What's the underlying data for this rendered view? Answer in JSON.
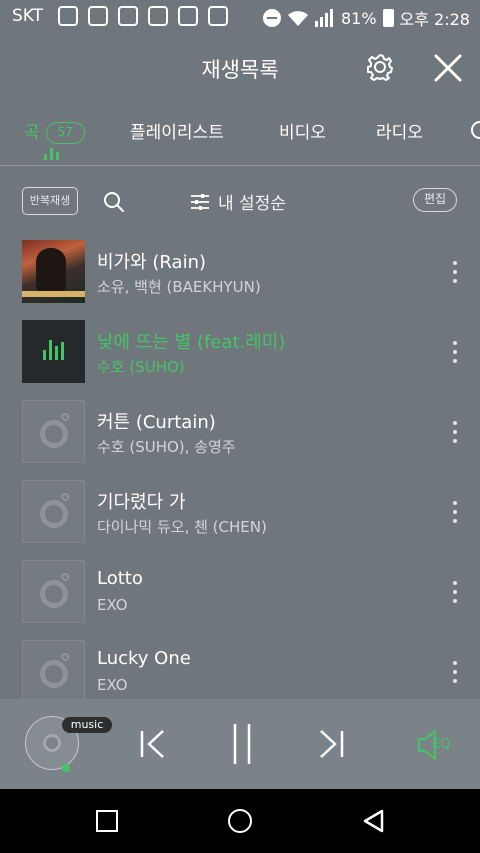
{
  "statusbar": {
    "carrier": "SKT",
    "battery": "81%",
    "time": "오후 2:28"
  },
  "header": {
    "title": "재생목록"
  },
  "tabs": [
    {
      "label": "곡",
      "count": "57"
    },
    {
      "label": "플레이리스트"
    },
    {
      "label": "비디오"
    },
    {
      "label": "라디오"
    }
  ],
  "toolbar": {
    "repeat": "반복재생",
    "sort": "내 설정순",
    "edit": "편집"
  },
  "songs": [
    {
      "title": "비가와 (Rain)",
      "artist": "소유, 백현 (BAEKHYUN)"
    },
    {
      "title": "낮에 뜨는 별 (feat.레미)",
      "artist": "수호 (SUHO)"
    },
    {
      "title": "커튼 (Curtain)",
      "artist": "수호 (SUHO), 송영주"
    },
    {
      "title": "기다렸다 가",
      "artist": "다이나믹 듀오, 첸 (CHEN)"
    },
    {
      "title": "Lotto",
      "artist": "EXO"
    },
    {
      "title": "Lucky One",
      "artist": "EXO"
    }
  ],
  "player": {
    "badge": "music",
    "eq": "EQ"
  },
  "colors": {
    "accent": "#45c466",
    "background": "#6f767c"
  }
}
